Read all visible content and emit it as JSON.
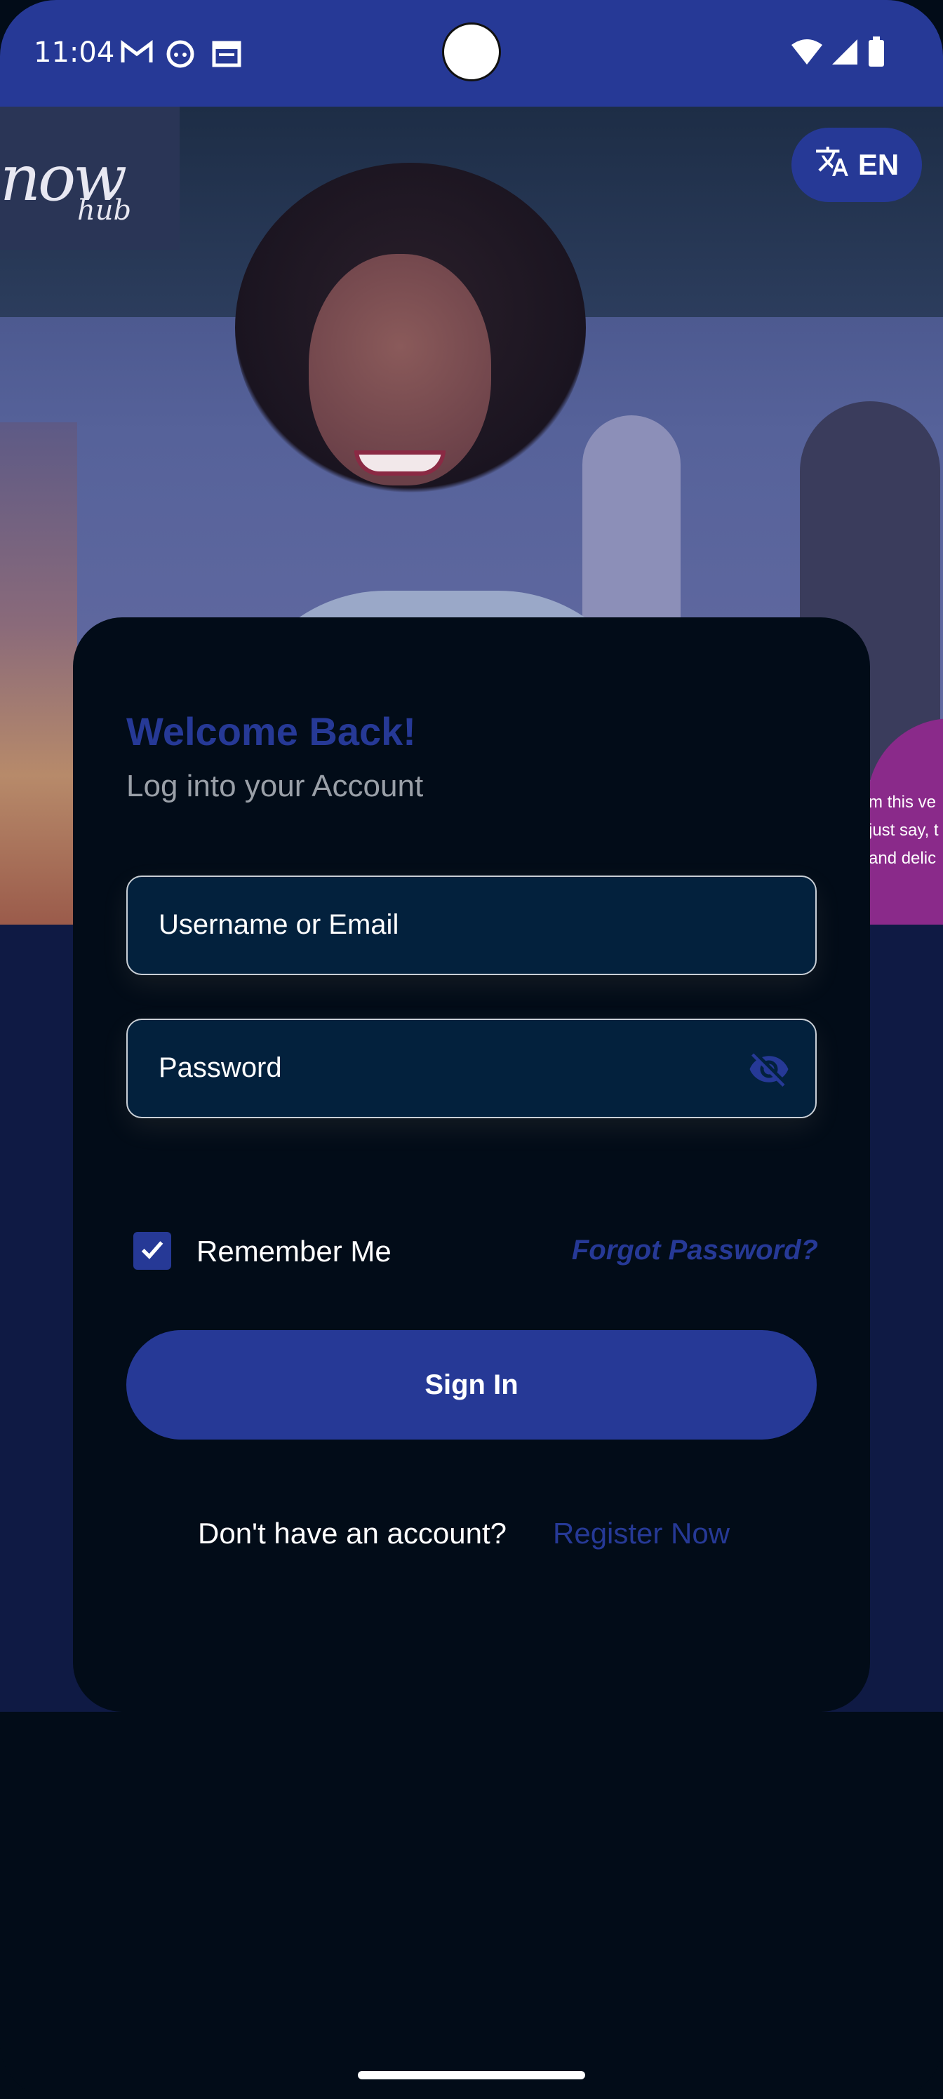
{
  "status_bar": {
    "time": "11:04",
    "icons": [
      "gmail-icon",
      "face-icon",
      "calendar-icon",
      "wifi-icon",
      "signal-icon",
      "battery-icon"
    ]
  },
  "hero": {
    "logo_main": "now",
    "logo_sub": "hub",
    "promo_lines": [
      "m this ve",
      "just say, t",
      "and delic"
    ]
  },
  "language": {
    "code": "EN",
    "icon": "translate-icon"
  },
  "login": {
    "title": "Welcome Back!",
    "subtitle": "Log into your Account",
    "username_placeholder": "Username or Email",
    "password_placeholder": "Password",
    "password_toggle_icon": "eye-off-icon",
    "remember_label": "Remember Me",
    "remember_checked": true,
    "forgot_label": "Forgot Password?",
    "signin_label": "Sign In",
    "no_account_text": "Don't have an account?",
    "register_label": "Register Now"
  },
  "colors": {
    "primary": "#263996",
    "background": "#020c18",
    "field_background": "#03213d",
    "lower_band": "#0f1a44"
  }
}
